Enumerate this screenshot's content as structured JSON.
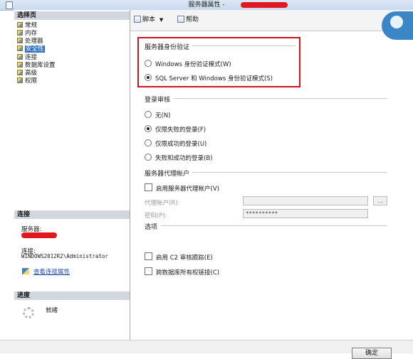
{
  "window": {
    "title": "服务器属性 -",
    "title_redacted": true
  },
  "sidebar": {
    "pages_header": "选择页",
    "pages": [
      {
        "label": "常规",
        "icon": "page-icon",
        "selected": false
      },
      {
        "label": "内存",
        "icon": "page-icon",
        "selected": false
      },
      {
        "label": "处理器",
        "icon": "page-icon",
        "selected": false
      },
      {
        "label": "安全性",
        "icon": "page-icon",
        "selected": true
      },
      {
        "label": "连接",
        "icon": "page-icon",
        "selected": false
      },
      {
        "label": "数据库设置",
        "icon": "page-icon",
        "selected": false
      },
      {
        "label": "高级",
        "icon": "page-icon",
        "selected": false
      },
      {
        "label": "权限",
        "icon": "page-icon",
        "selected": false
      }
    ],
    "connection_header": "连接",
    "server_label": "服务器:",
    "connection_label": "连接:",
    "connection_value": "WINDOWS2012R2\\Administrator",
    "view_connection_link": "查看连接属性",
    "progress_header": "进度",
    "progress_status": "就绪"
  },
  "toolbar": {
    "script_label": "脚本",
    "help_label": "帮助"
  },
  "security": {
    "auth_group_title": "服务器身份验证",
    "auth_windows": "Windows 身份验证模式(W)",
    "auth_mixed": "SQL Server 和 Windows 身份验证模式(S)",
    "auth_selected": "mixed",
    "audit_group_title": "登录审核",
    "audit_options": [
      "无(N)",
      "仅限失败的登录(F)",
      "仅限成功的登录(U)",
      "失败和成功的登录(B)"
    ],
    "audit_selected_index": 1,
    "proxy_group_title": "服务器代理帐户",
    "proxy_enable_label": "启用服务器代理帐户(V)",
    "proxy_account_label": "代理帐户(R):",
    "proxy_account_value": "",
    "password_label": "密码(P):",
    "password_value": "**********",
    "browse_button": "...",
    "options_group_title": "选项",
    "c2_audit_label": "启用 C2 审核跟踪(E)",
    "cross_db_label": "跨数据库所有权链接(C)"
  },
  "footer": {
    "ok_label": "确定"
  },
  "colors": {
    "highlight_box": "#d0141c",
    "selection": "#3470c2",
    "link": "#1f4fb5"
  }
}
